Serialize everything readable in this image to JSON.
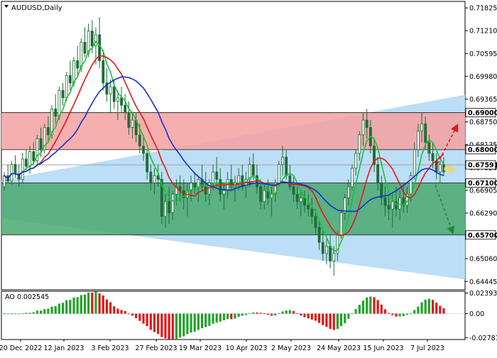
{
  "chart_data": {
    "type": "candlestick",
    "title": "AUDUSD,Daily",
    "symbol": "AUDUSD",
    "timeframe": "Daily",
    "price_axis": {
      "ylim": [
        0.6422,
        0.72
      ],
      "ticks": [
        "0.71825",
        "0.71210",
        "0.70595",
        "0.69980",
        "0.69365",
        "0.68750",
        "0.68135",
        "0.67520",
        "0.66905",
        "0.66290",
        "0.65675",
        "0.65060",
        "0.64445"
      ]
    },
    "x_axis": {
      "labels": [
        "20 Dec 2022",
        "12 Jan 2023",
        "3 Feb 2023",
        "27 Feb 2023",
        "19 Mar 2023",
        "10 Apr 2023",
        "2 May 2023",
        "24 May 2023",
        "15 Jun 2023",
        "7 Jul 2023"
      ]
    },
    "levels": [
      {
        "price": 0.69,
        "label": "0.69000",
        "color": "#d01c1c"
      },
      {
        "price": 0.68,
        "label": "0.68000",
        "color": "#d01c1c"
      },
      {
        "price": 0.67591,
        "label": "0.67591",
        "color": "#8a8a8a"
      },
      {
        "price": 0.671,
        "label": "0.67100",
        "color": "#1e6b36"
      },
      {
        "price": 0.657,
        "label": "0.65700",
        "color": "#1e6b36"
      }
    ],
    "zones": [
      {
        "name": "resistance",
        "from": 0.68,
        "to": 0.69,
        "color": "#f4a1a1"
      },
      {
        "name": "support",
        "from": 0.657,
        "to": 0.671,
        "color": "#4aa870"
      }
    ],
    "candles": [
      [
        0.67,
        0.674,
        0.669,
        0.673
      ],
      [
        0.673,
        0.676,
        0.671,
        0.6715
      ],
      [
        0.6715,
        0.677,
        0.6705,
        0.676
      ],
      [
        0.676,
        0.6785,
        0.6725,
        0.6735
      ],
      [
        0.6735,
        0.676,
        0.67,
        0.672
      ],
      [
        0.672,
        0.679,
        0.671,
        0.6775
      ],
      [
        0.6775,
        0.68,
        0.6745,
        0.6755
      ],
      [
        0.6755,
        0.681,
        0.6735,
        0.6795
      ],
      [
        0.6795,
        0.682,
        0.676,
        0.677
      ],
      [
        0.677,
        0.684,
        0.676,
        0.683
      ],
      [
        0.683,
        0.686,
        0.678,
        0.68
      ],
      [
        0.68,
        0.687,
        0.679,
        0.686
      ],
      [
        0.686,
        0.689,
        0.682,
        0.684
      ],
      [
        0.684,
        0.692,
        0.683,
        0.691
      ],
      [
        0.691,
        0.695,
        0.687,
        0.689
      ],
      [
        0.689,
        0.697,
        0.688,
        0.696
      ],
      [
        0.696,
        0.698,
        0.692,
        0.694
      ],
      [
        0.694,
        0.701,
        0.693,
        0.7
      ],
      [
        0.7,
        0.704,
        0.696,
        0.698
      ],
      [
        0.698,
        0.705,
        0.697,
        0.704
      ],
      [
        0.704,
        0.708,
        0.7,
        0.702
      ],
      [
        0.702,
        0.71,
        0.701,
        0.709
      ],
      [
        0.709,
        0.713,
        0.705,
        0.706
      ],
      [
        0.706,
        0.714,
        0.705,
        0.712
      ],
      [
        0.712,
        0.715,
        0.706,
        0.708
      ],
      [
        0.708,
        0.713,
        0.703,
        0.711
      ],
      [
        0.711,
        0.7158,
        0.702,
        0.704
      ],
      [
        0.704,
        0.707,
        0.696,
        0.698
      ],
      [
        0.698,
        0.702,
        0.693,
        0.695
      ],
      [
        0.695,
        0.699,
        0.69,
        0.697
      ],
      [
        0.697,
        0.699,
        0.691,
        0.693
      ],
      [
        0.693,
        0.696,
        0.688,
        0.694
      ],
      [
        0.694,
        0.697,
        0.69,
        0.692
      ],
      [
        0.692,
        0.695,
        0.688,
        0.69
      ],
      [
        0.69,
        0.693,
        0.684,
        0.686
      ],
      [
        0.686,
        0.69,
        0.683,
        0.688
      ],
      [
        0.688,
        0.69,
        0.682,
        0.684
      ],
      [
        0.684,
        0.687,
        0.679,
        0.681
      ],
      [
        0.681,
        0.684,
        0.677,
        0.679
      ],
      [
        0.679,
        0.68,
        0.672,
        0.674
      ],
      [
        0.674,
        0.676,
        0.669,
        0.671
      ],
      [
        0.671,
        0.675,
        0.668,
        0.673
      ],
      [
        0.673,
        0.676,
        0.67,
        0.672
      ],
      [
        0.672,
        0.674,
        0.66,
        0.662
      ],
      [
        0.662,
        0.668,
        0.659,
        0.666
      ],
      [
        0.666,
        0.67,
        0.66,
        0.663
      ],
      [
        0.663,
        0.669,
        0.661,
        0.668
      ],
      [
        0.668,
        0.672,
        0.665,
        0.67
      ],
      [
        0.67,
        0.673,
        0.666,
        0.669
      ],
      [
        0.669,
        0.672,
        0.664,
        0.667
      ],
      [
        0.667,
        0.671,
        0.662,
        0.669
      ],
      [
        0.669,
        0.673,
        0.666,
        0.671
      ],
      [
        0.671,
        0.674,
        0.668,
        0.67
      ],
      [
        0.67,
        0.673,
        0.666,
        0.672
      ],
      [
        0.672,
        0.676,
        0.669,
        0.67
      ],
      [
        0.67,
        0.674,
        0.666,
        0.668
      ],
      [
        0.668,
        0.672,
        0.665,
        0.671
      ],
      [
        0.671,
        0.676,
        0.669,
        0.674
      ],
      [
        0.674,
        0.678,
        0.67,
        0.672
      ],
      [
        0.672,
        0.675,
        0.666,
        0.668
      ],
      [
        0.668,
        0.671,
        0.664,
        0.669
      ],
      [
        0.669,
        0.674,
        0.667,
        0.672
      ],
      [
        0.672,
        0.676,
        0.669,
        0.67
      ],
      [
        0.67,
        0.673,
        0.666,
        0.671
      ],
      [
        0.671,
        0.675,
        0.669,
        0.673
      ],
      [
        0.673,
        0.676,
        0.669,
        0.67
      ],
      [
        0.67,
        0.674,
        0.667,
        0.672
      ],
      [
        0.672,
        0.678,
        0.67,
        0.676
      ],
      [
        0.676,
        0.679,
        0.672,
        0.673
      ],
      [
        0.673,
        0.676,
        0.668,
        0.67
      ],
      [
        0.67,
        0.672,
        0.664,
        0.666
      ],
      [
        0.666,
        0.671,
        0.664,
        0.669
      ],
      [
        0.669,
        0.672,
        0.665,
        0.667
      ],
      [
        0.667,
        0.67,
        0.662,
        0.668
      ],
      [
        0.668,
        0.672,
        0.666,
        0.671
      ],
      [
        0.671,
        0.677,
        0.67,
        0.676
      ],
      [
        0.676,
        0.681,
        0.673,
        0.678
      ],
      [
        0.678,
        0.68,
        0.672,
        0.673
      ],
      [
        0.673,
        0.676,
        0.669,
        0.67
      ],
      [
        0.67,
        0.673,
        0.666,
        0.668
      ],
      [
        0.668,
        0.67,
        0.664,
        0.666
      ],
      [
        0.666,
        0.669,
        0.662,
        0.667
      ],
      [
        0.667,
        0.669,
        0.663,
        0.665
      ],
      [
        0.665,
        0.668,
        0.662,
        0.664
      ],
      [
        0.664,
        0.667,
        0.66,
        0.662
      ],
      [
        0.662,
        0.664,
        0.657,
        0.659
      ],
      [
        0.659,
        0.661,
        0.653,
        0.655
      ],
      [
        0.655,
        0.658,
        0.65,
        0.652
      ],
      [
        0.652,
        0.656,
        0.649,
        0.654
      ],
      [
        0.654,
        0.657,
        0.648,
        0.65
      ],
      [
        0.65,
        0.654,
        0.646,
        0.652
      ],
      [
        0.652,
        0.658,
        0.65,
        0.657
      ],
      [
        0.657,
        0.664,
        0.656,
        0.663
      ],
      [
        0.663,
        0.668,
        0.661,
        0.667
      ],
      [
        0.667,
        0.672,
        0.665,
        0.67
      ],
      [
        0.67,
        0.676,
        0.669,
        0.675
      ],
      [
        0.675,
        0.68,
        0.673,
        0.679
      ],
      [
        0.679,
        0.685,
        0.677,
        0.684
      ],
      [
        0.684,
        0.69,
        0.681,
        0.688
      ],
      [
        0.688,
        0.691,
        0.683,
        0.686
      ],
      [
        0.686,
        0.688,
        0.679,
        0.681
      ],
      [
        0.681,
        0.683,
        0.674,
        0.676
      ],
      [
        0.676,
        0.678,
        0.669,
        0.671
      ],
      [
        0.671,
        0.673,
        0.665,
        0.667
      ],
      [
        0.667,
        0.67,
        0.662,
        0.665
      ],
      [
        0.665,
        0.668,
        0.661,
        0.664
      ],
      [
        0.664,
        0.668,
        0.659,
        0.666
      ],
      [
        0.666,
        0.67,
        0.662,
        0.664
      ],
      [
        0.664,
        0.669,
        0.661,
        0.667
      ],
      [
        0.667,
        0.671,
        0.663,
        0.665
      ],
      [
        0.665,
        0.67,
        0.663,
        0.668
      ],
      [
        0.668,
        0.674,
        0.666,
        0.673
      ],
      [
        0.673,
        0.682,
        0.672,
        0.68
      ],
      [
        0.68,
        0.687,
        0.678,
        0.685
      ],
      [
        0.685,
        0.69,
        0.682,
        0.687
      ],
      [
        0.687,
        0.689,
        0.68,
        0.682
      ],
      [
        0.682,
        0.684,
        0.677,
        0.679
      ],
      [
        0.679,
        0.682,
        0.675,
        0.677
      ],
      [
        0.677,
        0.679,
        0.672,
        0.674
      ],
      [
        0.674,
        0.677,
        0.671,
        0.676
      ],
      [
        0.676,
        0.678,
        0.673,
        0.674
      ]
    ],
    "moving_averages": [
      {
        "name": "green",
        "color": "#17c23a",
        "period": 5
      },
      {
        "name": "red",
        "color": "#e01818",
        "period": 10
      },
      {
        "name": "blue",
        "color": "#1530d0",
        "period": 20
      }
    ],
    "oscillator": {
      "name": "AO",
      "label": "AO 0.002545",
      "ylim": [
        -0.03,
        0.026
      ],
      "ticks": [
        "0.023939",
        "0.00",
        "-0.027812"
      ]
    }
  }
}
